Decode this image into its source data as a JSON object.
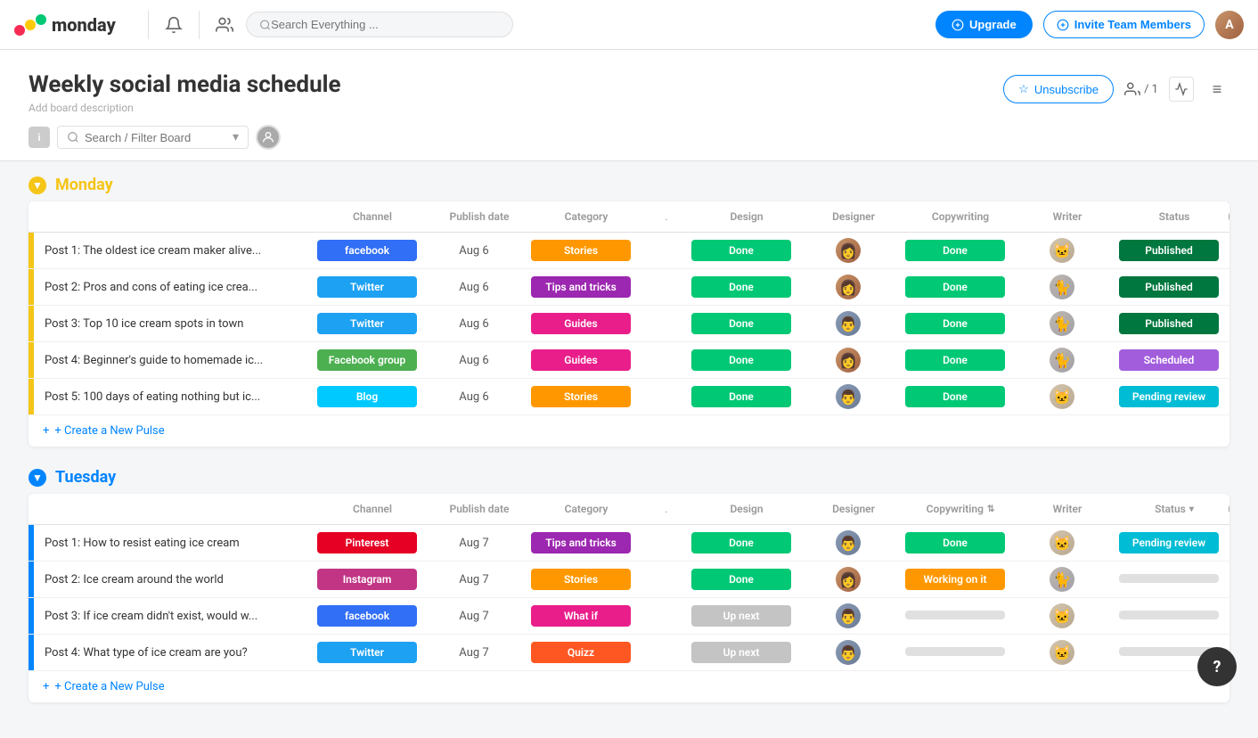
{
  "header": {
    "logo_text": "monday",
    "search_placeholder": "Search Everything ...",
    "upgrade_label": "Upgrade",
    "invite_label": "Invite Team Members"
  },
  "board": {
    "title": "Weekly social media schedule",
    "description": "Add board description",
    "unsubscribe_label": "Unsubscribe",
    "members_count": "/ 1",
    "filter_placeholder": "Search / Filter Board"
  },
  "columns": [
    "Channel",
    "Publish date",
    "Category",
    ".",
    "Design",
    "Designer",
    "Copywriting",
    "Writer",
    "Status"
  ],
  "groups": [
    {
      "id": "monday",
      "name": "Monday",
      "color": "#F5C518",
      "rows": [
        {
          "title": "Post 1: The oldest ice cream maker alive...",
          "channel": "facebook",
          "channel_color": "#316FF6",
          "date": "Aug 6",
          "category": "Stories",
          "category_color": "#FF9800",
          "dot": "",
          "design": "Done",
          "design_color": "#00c875",
          "designer_avatar": "female1",
          "copywriting": "Done",
          "copy_color": "#00c875",
          "writer_avatar": "cat1",
          "status": "Published",
          "status_color": "#00773E"
        },
        {
          "title": "Post 2: Pros and cons of eating ice crea...",
          "channel": "Twitter",
          "channel_color": "#1DA1F2",
          "date": "Aug 6",
          "category": "Tips and tricks",
          "category_color": "#9C27B0",
          "dot": "",
          "design": "Done",
          "design_color": "#00c875",
          "designer_avatar": "female1",
          "copywriting": "Done",
          "copy_color": "#00c875",
          "writer_avatar": "cat2",
          "status": "Published",
          "status_color": "#00773E"
        },
        {
          "title": "Post 3: Top 10 ice cream spots in town",
          "channel": "Twitter",
          "channel_color": "#1DA1F2",
          "date": "Aug 6",
          "category": "Guides",
          "category_color": "#E91E8A",
          "dot": "",
          "design": "Done",
          "design_color": "#00c875",
          "designer_avatar": "male1",
          "copywriting": "Done",
          "copy_color": "#00c875",
          "writer_avatar": "cat2",
          "status": "Published",
          "status_color": "#00773E"
        },
        {
          "title": "Post 4: Beginner's guide to homemade ic...",
          "channel": "Facebook group",
          "channel_color": "#4CAF50",
          "date": "Aug 6",
          "category": "Guides",
          "category_color": "#E91E8A",
          "dot": "",
          "design": "Done",
          "design_color": "#00c875",
          "designer_avatar": "female1",
          "copywriting": "Done",
          "copy_color": "#00c875",
          "writer_avatar": "cat2",
          "status": "Scheduled",
          "status_color": "#A25DDC"
        },
        {
          "title": "Post 5: 100 days of eating nothing but ic...",
          "channel": "Blog",
          "channel_color": "#00c9ff",
          "date": "Aug 6",
          "category": "Stories",
          "category_color": "#FF9800",
          "dot": "",
          "design": "Done",
          "design_color": "#00c875",
          "designer_avatar": "male1",
          "copywriting": "Done",
          "copy_color": "#00c875",
          "writer_avatar": "cat1",
          "status": "Pending review",
          "status_color": "#00BCD4"
        }
      ]
    },
    {
      "id": "tuesday",
      "name": "Tuesday",
      "color": "#0085ff",
      "rows": [
        {
          "title": "Post 1: How to resist eating ice cream",
          "channel": "Pinterest",
          "channel_color": "#E60023",
          "date": "Aug 7",
          "category": "Tips and tricks",
          "category_color": "#9C27B0",
          "dot": "",
          "design": "Done",
          "design_color": "#00c875",
          "designer_avatar": "male1",
          "copywriting": "Done",
          "copy_color": "#00c875",
          "writer_avatar": "cat1",
          "status": "Pending review",
          "status_color": "#00BCD4"
        },
        {
          "title": "Post 2: Ice cream around the world",
          "channel": "Instagram",
          "channel_color": "#C13584",
          "date": "Aug 7",
          "category": "Stories",
          "category_color": "#FF9800",
          "dot": "",
          "design": "Done",
          "design_color": "#00c875",
          "designer_avatar": "female1",
          "copywriting": "Working on it",
          "copy_color": "#FF9800",
          "writer_avatar": "cat2",
          "status": "",
          "status_color": "#e0e0e0"
        },
        {
          "title": "Post 3: If ice cream didn't exist, would w...",
          "channel": "facebook",
          "channel_color": "#316FF6",
          "date": "Aug 7",
          "category": "What if",
          "category_color": "#E91E8A",
          "dot": "",
          "design": "Up next",
          "design_color": "#c4c4c4",
          "designer_avatar": "male1",
          "copywriting": "",
          "copy_color": "#e0e0e0",
          "writer_avatar": "cat1",
          "status": "",
          "status_color": "#e0e0e0"
        },
        {
          "title": "Post 4: What type of ice cream are you?",
          "channel": "Twitter",
          "channel_color": "#1DA1F2",
          "date": "Aug 7",
          "category": "Quizz",
          "category_color": "#FF5722",
          "dot": "",
          "design": "Up next",
          "design_color": "#c4c4c4",
          "designer_avatar": "male1",
          "copywriting": "",
          "copy_color": "#e0e0e0",
          "writer_avatar": "cat1",
          "status": "",
          "status_color": "#e0e0e0"
        }
      ]
    }
  ],
  "ui": {
    "create_pulse_label": "+ Create a New Pulse",
    "help_label": "?",
    "plus_icon": "+",
    "star_icon": "☆",
    "bell_icon": "🔔",
    "people_icon": "👥",
    "chevron_down": "▼",
    "sort_icon": "⇅",
    "menu_icon": "≡",
    "add_icon": "⊕",
    "search_icon": "🔍"
  }
}
